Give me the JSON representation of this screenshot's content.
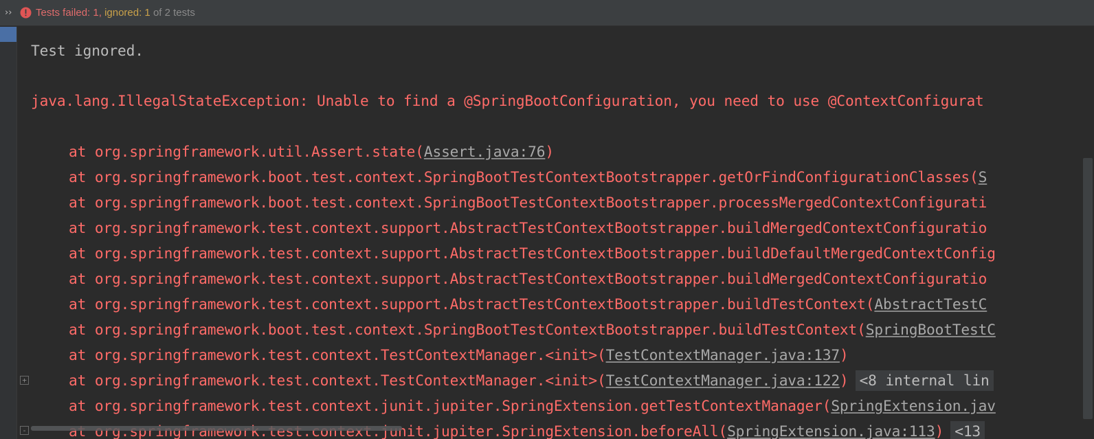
{
  "status_bar": {
    "expand_icon": "double-chevron-right-icon",
    "status_icon": "error-circle-icon",
    "failed": "Tests failed: 1",
    "sep": ", ",
    "ignored": "ignored: 1",
    "of_total": " of 2 tests"
  },
  "console": {
    "ignored_message": "Test ignored.",
    "exception": "java.lang.IllegalStateException: Unable to find a @SpringBootConfiguration, you need to use @ContextConfigurat",
    "frames": [
      {
        "prefix": "at org.springframework.util.Assert.state(",
        "link": "Assert.java:76",
        "suffix": ")"
      },
      {
        "prefix": "at org.springframework.boot.test.context.SpringBootTestContextBootstrapper.getOrFindConfigurationClasses(",
        "link": "S",
        "suffix": ""
      },
      {
        "prefix": "at org.springframework.boot.test.context.SpringBootTestContextBootstrapper.processMergedContextConfigurati",
        "link": "",
        "suffix": ""
      },
      {
        "prefix": "at org.springframework.test.context.support.AbstractTestContextBootstrapper.buildMergedContextConfiguratio",
        "link": "",
        "suffix": ""
      },
      {
        "prefix": "at org.springframework.test.context.support.AbstractTestContextBootstrapper.buildDefaultMergedContextConfig",
        "link": "",
        "suffix": ""
      },
      {
        "prefix": "at org.springframework.test.context.support.AbstractTestContextBootstrapper.buildMergedContextConfiguratio",
        "link": "",
        "suffix": ""
      },
      {
        "prefix": "at org.springframework.test.context.support.AbstractTestContextBootstrapper.buildTestContext(",
        "link": "AbstractTestC",
        "suffix": ""
      },
      {
        "prefix": "at org.springframework.boot.test.context.SpringBootTestContextBootstrapper.buildTestContext(",
        "link": "SpringBootTestC",
        "suffix": ""
      },
      {
        "prefix": "at org.springframework.test.context.TestContextManager.<init>(",
        "link": "TestContextManager.java:137",
        "suffix": ")"
      },
      {
        "prefix": "at org.springframework.test.context.TestContextManager.<init>(",
        "link": "TestContextManager.java:122",
        "suffix": ")",
        "badge": "<8 internal lin"
      },
      {
        "prefix": "at org.springframework.test.context.junit.jupiter.SpringExtension.getTestContextManager(",
        "link": "SpringExtension.jav",
        "suffix": ""
      },
      {
        "prefix": "at org.springframework.test.context.junit.jupiter.SpringExtension.beforeAll(",
        "link": "SpringExtension.java:113",
        "suffix": ")",
        "badge": "<13"
      }
    ]
  },
  "colors": {
    "background": "#2b2b2b",
    "error_text": "#ff6b68",
    "plain_text": "#bbbbbb",
    "link_text": "#a8a8a8",
    "status_failed": "#e06c6c",
    "status_ignored": "#c9a14a"
  }
}
